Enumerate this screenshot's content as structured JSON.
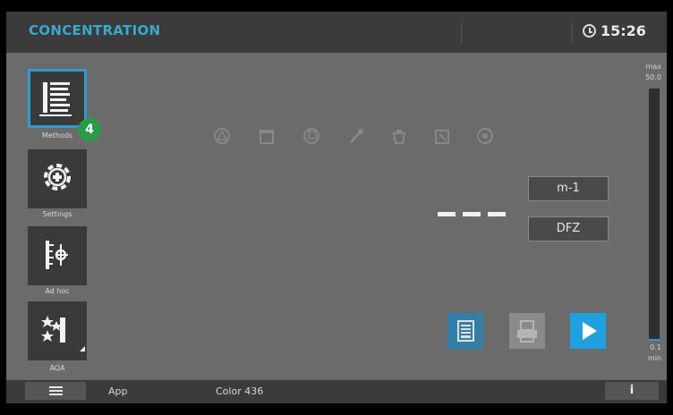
{
  "header": {
    "title": "CONCENTRATION",
    "time": "15:26",
    "clock_icon": "clock-icon"
  },
  "sidebar": {
    "items": [
      {
        "label": "Methods",
        "icon": "methods-list-icon",
        "active": true,
        "badge": "4"
      },
      {
        "label": "Settings",
        "icon": "gear-icon",
        "active": false
      },
      {
        "label": "Ad hoc",
        "icon": "ad-hoc-icon",
        "active": false
      },
      {
        "label": "AQA",
        "icon": "aqa-stars-icon",
        "active": false
      }
    ]
  },
  "status_icons": [
    "warning-triangle-icon",
    "calendar-icon",
    "cuvette-icon",
    "pipette-icon",
    "bin-icon",
    "export-icon",
    "record-icon"
  ],
  "measurement": {
    "value": "- - -",
    "mode_buttons": [
      "m-1",
      "DFZ"
    ]
  },
  "actions": {
    "save_icon": "save-icon",
    "print_icon": "print-icon",
    "start_icon": "play-icon"
  },
  "scale": {
    "max_label": "max",
    "max_value": "50.0",
    "min_value": "0.1",
    "min_label": "min"
  },
  "footer": {
    "app_label": "App",
    "method_name": "Color 436",
    "info_label": "i",
    "menu_icon": "hamburger-menu-icon"
  },
  "colors": {
    "accent": "#2d9bd3",
    "title": "#3aa7cf",
    "badge": "#2a9b47",
    "background": "#6b6b6b",
    "bars": "#3b3b3b"
  }
}
